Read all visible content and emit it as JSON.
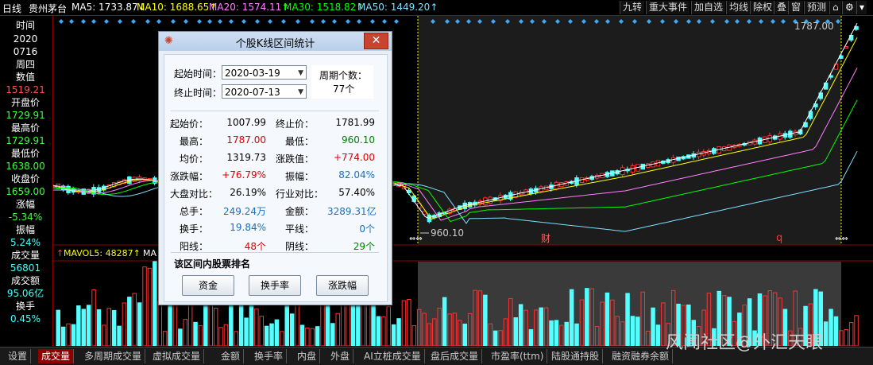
{
  "topbar": {
    "period": "日线",
    "stock": "贵州茅台",
    "ma5": "MA5: 1733.87↓",
    "ma10": "MA10: 1688.65↑",
    "ma20": "MA20: 1574.11↑",
    "ma30": "MA30: 1518.82↑",
    "ma50": "MA50: 1449.20↑",
    "buttons": [
      "九转",
      "重大事件",
      "加自选",
      "均线",
      "除权",
      "叠",
      "窗",
      "预测"
    ]
  },
  "left_panel": [
    {
      "label": "时间",
      "value": "2020"
    },
    {
      "label": "",
      "value": "0716"
    },
    {
      "label": "",
      "value": "周四"
    },
    {
      "label": "数值",
      "value": "1519.21"
    },
    {
      "label": "开盘价",
      "value": "1729.91"
    },
    {
      "label": "最高价",
      "value": "1729.91"
    },
    {
      "label": "最低价",
      "value": "1638.00"
    },
    {
      "label": "收盘价",
      "value": "1659.00"
    },
    {
      "label": "涨幅",
      "value": "-5.34%"
    },
    {
      "label": "振幅",
      "value": "5.24%"
    },
    {
      "label": "成交量",
      "value": "56801"
    },
    {
      "label": "成交额",
      "value": "95.06亿"
    },
    {
      "label": "换手",
      "value": "0.45%"
    }
  ],
  "chart": {
    "high_label": "1787.00",
    "low_label": "960.10",
    "marker_cai": "财",
    "marker_q": "q",
    "vol_label": "MAVOL5: 48287↑",
    "vol_label2": "MA"
  },
  "dialog": {
    "title": "个股K线区间统计",
    "start_label": "起始时间：",
    "start_value": "2020-03-19",
    "end_label": "终止时间：",
    "end_value": "2020-07-13",
    "period_label": "周期个数：",
    "period_value": "77个",
    "stats": [
      {
        "l1": "起始价：",
        "v1": "1007.99",
        "c1": "#000",
        "l2": "终止价：",
        "v2": "1781.99",
        "c2": "#000"
      },
      {
        "l1": "最高：",
        "v1": "1787.00",
        "c1": "#e00000",
        "l2": "最低：",
        "v2": "960.10",
        "c2": "#008000"
      },
      {
        "l1": "均价：",
        "v1": "1319.73",
        "c1": "#000",
        "l2": "涨跌值：",
        "v2": "+774.00",
        "c2": "#e00000"
      },
      {
        "l1": "涨跌幅：",
        "v1": "+76.79%",
        "c1": "#e00000",
        "l2": "振幅：",
        "v2": "82.04%",
        "c2": "#1a6fc0"
      },
      {
        "l1": "大盘对比：",
        "v1": "26.19%",
        "c1": "#000",
        "l2": "行业对比：",
        "v2": "57.40%",
        "c2": "#000"
      },
      {
        "l1": "总手：",
        "v1": "249.24万",
        "c1": "#1a6fc0",
        "l2": "金额：",
        "v2": "3289.31亿",
        "c2": "#1a6fc0"
      },
      {
        "l1": "换手：",
        "v1": "19.84%",
        "c1": "#1a6fc0",
        "l2": "平线：",
        "v2": "0个",
        "c2": "#1a6fc0"
      },
      {
        "l1": "阳线：",
        "v1": "48个",
        "c1": "#e00000",
        "l2": "阴线：",
        "v2": "29个",
        "c2": "#008000"
      }
    ],
    "rank_title": "该区间内股票排名",
    "btn1": "资金",
    "btn2": "换手率",
    "btn3": "涨跌幅"
  },
  "tabs": [
    "设置",
    "成交量",
    "多周期成交量",
    "虚拟成交量",
    "金额",
    "换手率",
    "内盘",
    "外盘",
    "AI立桩成交量",
    "盘后成交量",
    "市盈率(ttm)",
    "陆股通持股",
    "融资融券余额"
  ],
  "watermark": "风闻社区@外汇天眼",
  "colors": {
    "up": "#ff3232",
    "down": "#54ffff",
    "ma5": "#ffffff",
    "ma10": "#ffff00",
    "ma20": "#ff80ff",
    "ma30": "#00ff00",
    "ma50": "#7fdfff"
  }
}
